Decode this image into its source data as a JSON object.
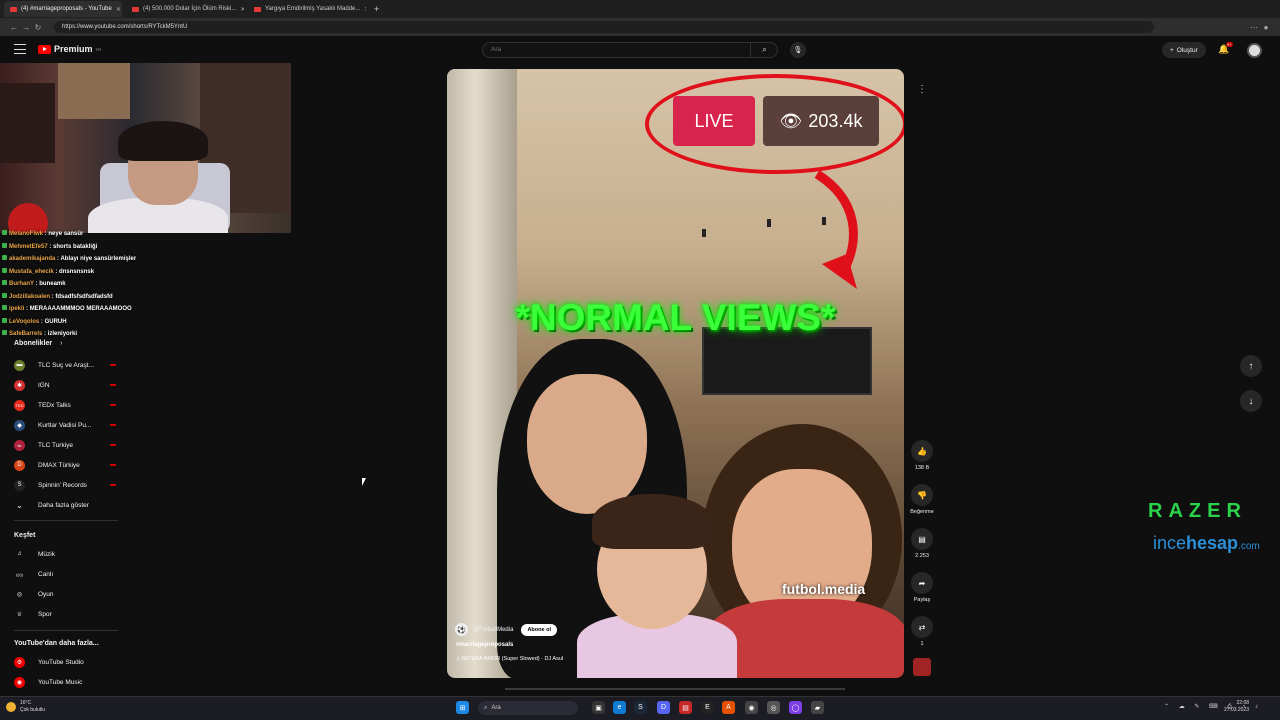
{
  "browser": {
    "tabs": [
      {
        "title": "(4) #marriageproposals - YouTube",
        "active": true
      },
      {
        "title": "(4) 500.000 Dolar İçin Ölüm Riski...",
        "active": false
      },
      {
        "title": "Yargıya Emdirilmiş Yasaklı Madde...",
        "active": false
      }
    ],
    "new_tab": "+",
    "url": "https://www.youtube.com/shorts/RYTckM5YntU"
  },
  "header": {
    "logo_text": "Premium",
    "logo_sup": "TR",
    "search_placeholder": "Ara",
    "create_label": "Oluştur",
    "notif_count": "9+"
  },
  "chat": [
    {
      "user": "MelanoFlwk",
      "msg": "neye sansür"
    },
    {
      "user": "MehmetEfe57",
      "msg": "shorts batakliği"
    },
    {
      "user": "akademikajanda",
      "msg": "Ablayı niye sansürlemişler"
    },
    {
      "user": "Mustafa_ehecik",
      "msg": "dnsnsnsnsk"
    },
    {
      "user": "BurhanY",
      "msg": "buneamk"
    },
    {
      "user": "Jodzillakoalen",
      "msg": "fdsadfsfsdfsdfadsfd"
    },
    {
      "user": "ipekli",
      "msg": "MERAAAAMMMOO MERAAAMOOO"
    },
    {
      "user": "LeVoqolos",
      "msg": "GURUH"
    },
    {
      "user": "SafeBarrels",
      "msg": "izleniyorki"
    }
  ],
  "sidebar": {
    "subs_title": "Abonelikler",
    "subs_chevron": "›",
    "subscriptions": [
      {
        "label": "TLC Suç ve Araşt...",
        "color": "#6a7d2a",
        "glyph": "▬"
      },
      {
        "label": "IGN",
        "color": "#d32f2f",
        "glyph": "✱"
      },
      {
        "label": "TEDx Talks",
        "color": "#e62b1e",
        "glyph": "TED"
      },
      {
        "label": "Kurtlar Vadisi Pu...",
        "color": "#2a4d7a",
        "glyph": "◆"
      },
      {
        "label": "TLC Turkiye",
        "color": "#b0203a",
        "glyph": "tlc"
      },
      {
        "label": "DMAX Türkiye",
        "color": "#d84315",
        "glyph": "D"
      },
      {
        "label": "Spinnin' Records",
        "color": "#222222",
        "glyph": "S"
      }
    ],
    "show_more": "Daha fazla göster",
    "explore_title": "Keşfet",
    "explore": [
      {
        "label": "Müzik",
        "glyph": "♫"
      },
      {
        "label": "Canlı",
        "glyph": "((•))"
      },
      {
        "label": "Oyun",
        "glyph": "◎"
      },
      {
        "label": "Spor",
        "glyph": "♕"
      }
    ],
    "more_title": "YouTube'dan daha fazla...",
    "more": [
      {
        "label": "YouTube Studio",
        "glyph": "⚙"
      },
      {
        "label": "YouTube Music",
        "glyph": "◉"
      }
    ]
  },
  "video": {
    "live_label": "LIVE",
    "views_label": "203.4k",
    "overlay_text": "*NORMAL VIEWS*",
    "watermark": "futbol.media",
    "channel": "@FutballMedia",
    "subscribe": "Abone ol",
    "hashtag": "#marriageproposals",
    "music": "NO ERA AMOR (Super Slowed) · DJ Asul"
  },
  "actions": {
    "like_count": "138 B",
    "dislike_label": "Beğenme",
    "comment_count": "2.253",
    "share_label": "Paylaş",
    "remix_count": "1"
  },
  "sponsor": {
    "razer": "RAZER",
    "incehesap_a": "ince",
    "incehesap_b": "hesap",
    "incehesap_c": ".com"
  },
  "taskbar": {
    "weather_temp": "16°C",
    "weather_desc": "Çok bulutlu",
    "search_label": "Ara",
    "time": "22:08",
    "date": "27.03.2023"
  },
  "colors": {
    "accent": "#ff0000",
    "live": "#d8234c",
    "neon": "#3cff3c",
    "razer": "#2bd34a",
    "incehesap": "#2a8fd7"
  }
}
